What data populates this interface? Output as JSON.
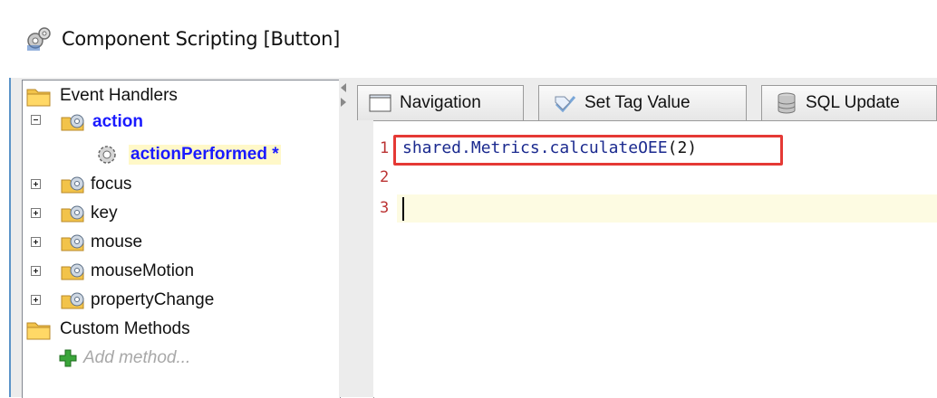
{
  "window": {
    "title": "Component Scripting [Button]",
    "icon": "gears-icon"
  },
  "tree": {
    "event_handlers_label": "Event Handlers",
    "items": [
      {
        "label": "action",
        "expanded": true,
        "selected_style": true
      },
      {
        "label": "actionPerformed *",
        "child": true,
        "selected": true
      },
      {
        "label": "focus"
      },
      {
        "label": "key"
      },
      {
        "label": "mouse"
      },
      {
        "label": "mouseMotion"
      },
      {
        "label": "propertyChange"
      }
    ],
    "custom_methods_label": "Custom Methods",
    "add_method_label": "Add method..."
  },
  "tabs": [
    {
      "label": "Navigation",
      "icon": "window-icon"
    },
    {
      "label": "Set Tag Value",
      "icon": "tag-check-icon"
    },
    {
      "label": "SQL Update",
      "icon": "database-icon"
    }
  ],
  "editor": {
    "line_numbers": [
      "1",
      "2",
      "3"
    ],
    "code_line_1": {
      "obj": "shared.Metrics.calculateOEE",
      "open": "(",
      "arg": "2",
      "close": ")"
    }
  },
  "colors": {
    "selected_text": "#1a1aff",
    "highlight_border": "#e53935",
    "line_number": "#b33333",
    "current_line": "#fdfbe2"
  }
}
